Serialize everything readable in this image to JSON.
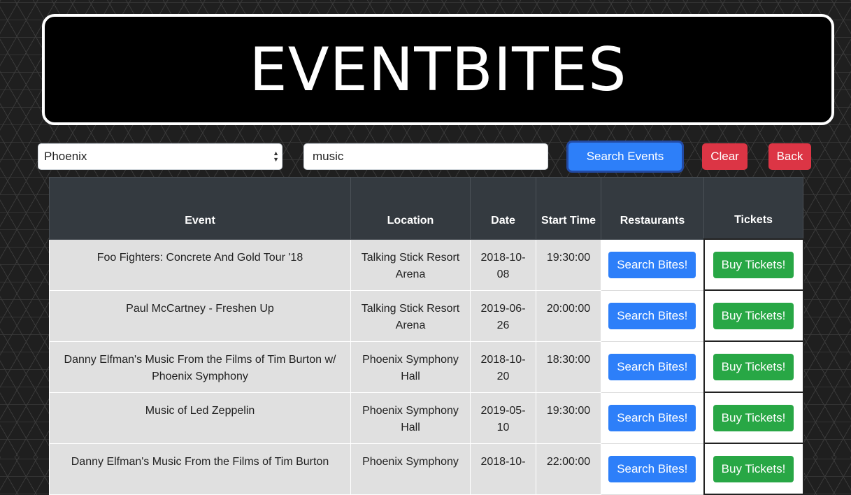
{
  "header": {
    "title": "EVENTBITES"
  },
  "controls": {
    "city_value": "Phoenix",
    "keyword_value": "music",
    "search_label": "Search Events",
    "clear_label": "Clear",
    "back_label": "Back"
  },
  "table": {
    "columns": [
      "Event",
      "Location",
      "Date",
      "Start Time",
      "Restaurants",
      "Tickets"
    ],
    "rows": [
      {
        "event": "Foo Fighters: Concrete And Gold Tour '18",
        "location": "Talking Stick Resort Arena",
        "date": "2018-10-08",
        "time": "19:30:00",
        "bites": "Search Bites!",
        "tickets": "Buy Tickets!"
      },
      {
        "event": "Paul McCartney - Freshen Up",
        "location": "Talking Stick Resort Arena",
        "date": "2019-06-26",
        "time": "20:00:00",
        "bites": "Search Bites!",
        "tickets": "Buy Tickets!"
      },
      {
        "event": "Danny Elfman's Music From the Films of Tim Burton w/ Phoenix Symphony",
        "location": "Phoenix Symphony Hall",
        "date": "2018-10-20",
        "time": "18:30:00",
        "bites": "Search Bites!",
        "tickets": "Buy Tickets!"
      },
      {
        "event": "Music of Led Zeppelin",
        "location": "Phoenix Symphony Hall",
        "date": "2019-05-10",
        "time": "19:30:00",
        "bites": "Search Bites!",
        "tickets": "Buy Tickets!"
      },
      {
        "event": "Danny Elfman's Music From the Films of Tim Burton",
        "location": "Phoenix Symphony",
        "date": "2018-10-",
        "time": "22:00:00",
        "bites": "Search Bites!",
        "tickets": "Buy Tickets!"
      }
    ]
  },
  "colors": {
    "primary": "#2d7ff9",
    "danger": "#dc3545",
    "success": "#28a745",
    "table_head": "#343a40"
  }
}
